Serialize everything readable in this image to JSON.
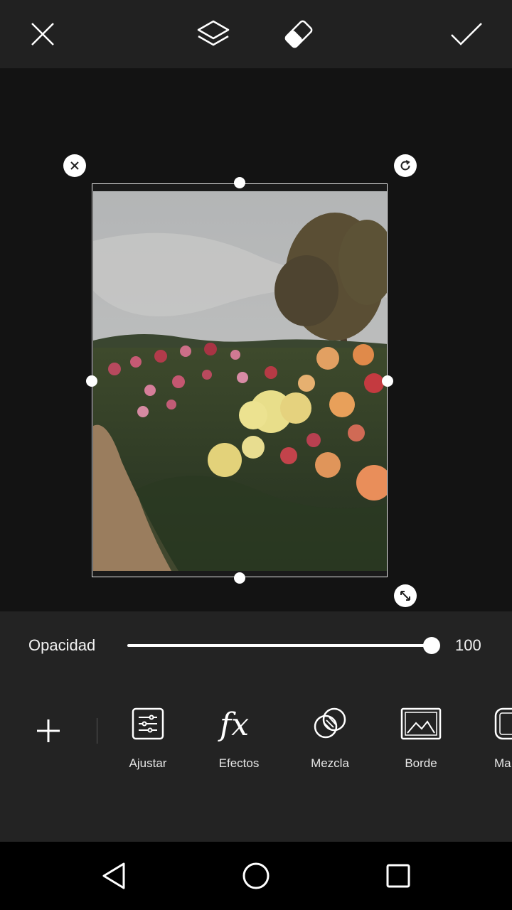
{
  "topbar": {
    "close_icon": "close-icon",
    "layers_icon": "layers-icon",
    "eraser_icon": "eraser-icon",
    "apply_icon": "check-icon"
  },
  "opacity": {
    "label": "Opacidad",
    "value": "100",
    "level": 1.0
  },
  "tools": [
    {
      "label": "Ajustar",
      "icon": "adjust-icon"
    },
    {
      "label": "Efectos",
      "icon": "fx-icon"
    },
    {
      "label": "Mezcla",
      "icon": "blend-icon"
    },
    {
      "label": "Borde",
      "icon": "border-icon"
    },
    {
      "label": "Ma",
      "icon": "mask-icon"
    }
  ],
  "colors": {
    "background": "#131313",
    "toolbar": "#212121",
    "panel": "#232323",
    "navbar": "#000000"
  }
}
